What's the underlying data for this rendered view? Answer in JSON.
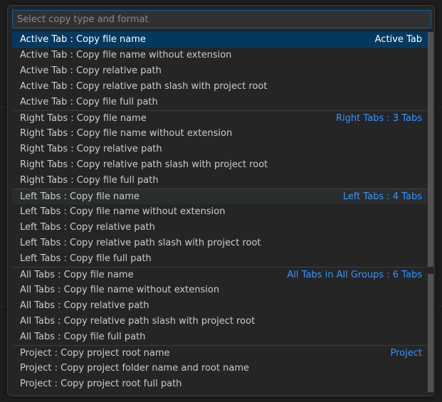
{
  "search": {
    "placeholder": "Select copy type and format",
    "value": ""
  },
  "groups": [
    {
      "tag": "Active Tab",
      "items": [
        "Active Tab : Copy file name",
        "Active Tab : Copy file name without extension",
        "Active Tab : Copy relative path",
        "Active Tab : Copy relative path slash with project root",
        "Active Tab : Copy file full path"
      ]
    },
    {
      "tag": "Right Tabs : 3 Tabs",
      "items": [
        "Right Tabs : Copy file name",
        "Right Tabs : Copy file name without extension",
        "Right Tabs : Copy relative path",
        "Right Tabs : Copy relative path slash with project root",
        "Right Tabs : Copy file full path"
      ]
    },
    {
      "tag": "Left Tabs : 4 Tabs",
      "items": [
        "Left Tabs : Copy file name",
        "Left Tabs : Copy file name without extension",
        "Left Tabs : Copy relative path",
        "Left Tabs : Copy relative path slash with project root",
        "Left Tabs : Copy file full path"
      ]
    },
    {
      "tag": "All Tabs in All Groups : 6 Tabs",
      "items": [
        "All Tabs : Copy file name",
        "All Tabs : Copy file name without extension",
        "All Tabs : Copy relative path",
        "All Tabs : Copy relative path slash with project root",
        "All Tabs : Copy file full path"
      ]
    },
    {
      "tag": "Project",
      "items": [
        "Project : Copy project root name",
        "Project : Copy project folder name and root name",
        "Project : Copy project root full path"
      ]
    }
  ],
  "selected": "Active Tab : Copy file name",
  "hovered": "Left Tabs : Copy file name",
  "colors": {
    "accent": "#3794ff",
    "selection": "#04395e",
    "focus_border": "#0e639c"
  }
}
